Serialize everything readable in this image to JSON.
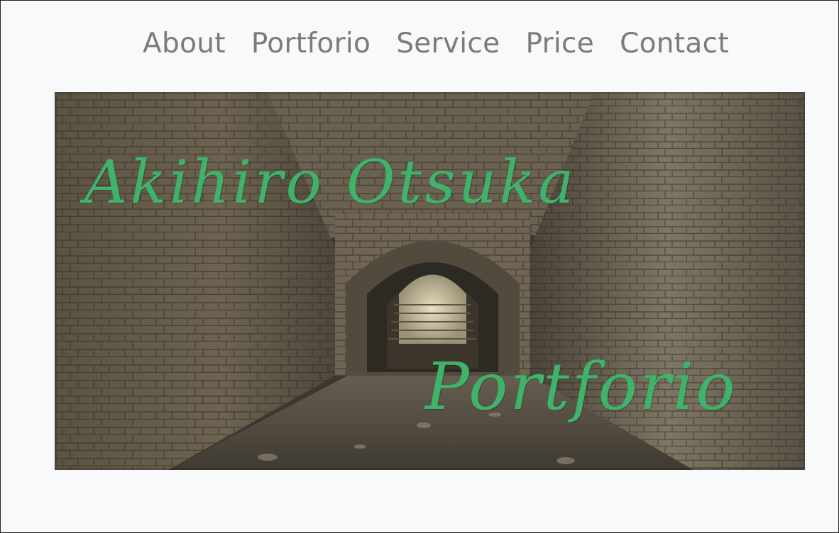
{
  "nav": {
    "items": [
      {
        "label": "About"
      },
      {
        "label": "Portforio"
      },
      {
        "label": "Service"
      },
      {
        "label": "Price"
      },
      {
        "label": "Contact"
      }
    ]
  },
  "hero": {
    "title": "Akihiro Otsuka",
    "subtitle": "Portforio",
    "text_color": "#3fb36a",
    "image": "stone-tunnel-corridor-photo"
  }
}
